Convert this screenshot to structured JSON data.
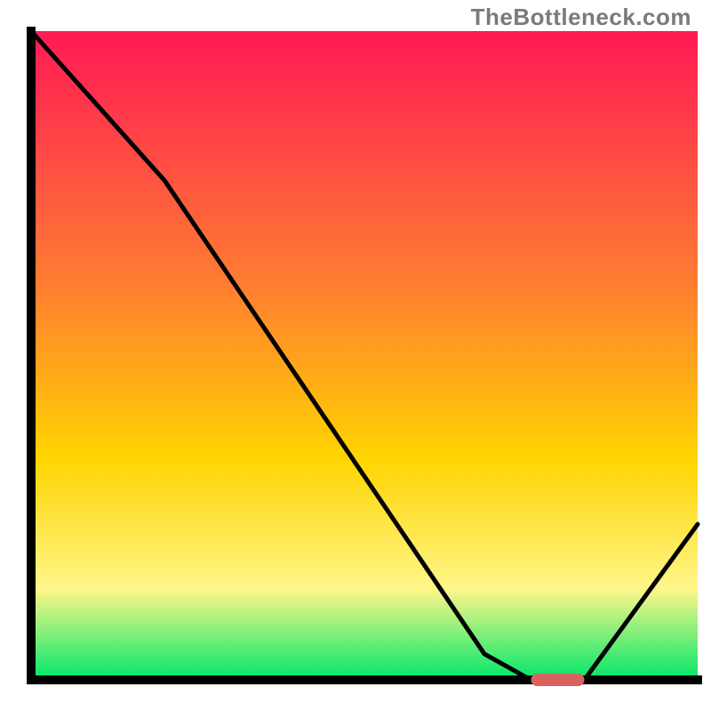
{
  "watermark": "TheBottleneck.com",
  "colors": {
    "top": "#ff1a55",
    "mid1": "#ff7a33",
    "mid2": "#ffd400",
    "mid3": "#fff68a",
    "bottom": "#00e76a",
    "axis": "#000000",
    "curve": "#000000",
    "marker": "#d9625f"
  },
  "chart_data": {
    "type": "line",
    "title": "",
    "xlabel": "",
    "ylabel": "",
    "xlim": [
      0,
      100
    ],
    "ylim": [
      0,
      100
    ],
    "series": [
      {
        "name": "curve",
        "x": [
          0,
          20,
          68,
          75,
          83,
          100
        ],
        "y": [
          100,
          77,
          4,
          0,
          0,
          24
        ]
      }
    ],
    "marker": {
      "x_start": 75,
      "x_end": 83,
      "y": 0
    }
  }
}
